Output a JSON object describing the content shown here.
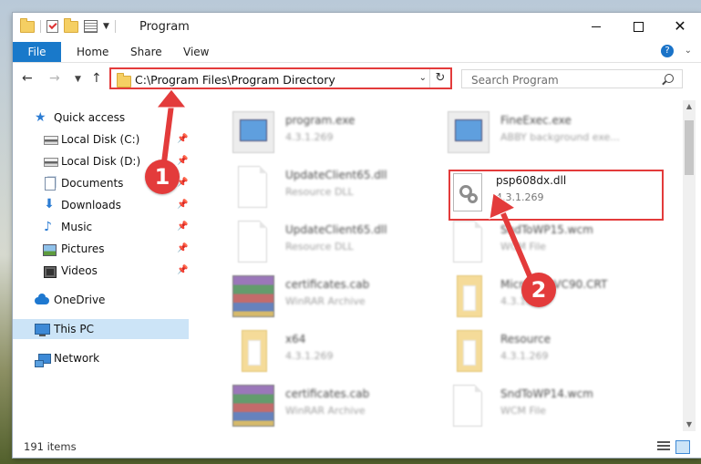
{
  "window": {
    "title": "Program"
  },
  "ribbon": {
    "tabs": [
      "File",
      "Home",
      "Share",
      "View"
    ]
  },
  "address": {
    "path": "C:\\Program Files\\Program Directory"
  },
  "search": {
    "placeholder": "Search Program"
  },
  "sidebar": {
    "items": [
      {
        "label": "Quick access",
        "icon": "star-icon"
      },
      {
        "label": "Local Disk (C:)",
        "icon": "disk-icon",
        "pinned": true
      },
      {
        "label": "Local Disk (D:)",
        "icon": "disk-icon",
        "pinned": true
      },
      {
        "label": "Documents",
        "icon": "documents-icon",
        "pinned": true
      },
      {
        "label": "Downloads",
        "icon": "download-icon",
        "pinned": true
      },
      {
        "label": "Music",
        "icon": "music-icon",
        "pinned": true
      },
      {
        "label": "Pictures",
        "icon": "pictures-icon",
        "pinned": true
      },
      {
        "label": "Videos",
        "icon": "video-icon",
        "pinned": true
      },
      {
        "label": "OneDrive",
        "icon": "cloud-icon"
      },
      {
        "label": "This PC",
        "icon": "computer-icon",
        "selected": true
      },
      {
        "label": "Network",
        "icon": "network-icon"
      }
    ]
  },
  "files": [
    {
      "name": "program.exe",
      "sub": "4.3.1.269",
      "icon": "exe"
    },
    {
      "name": "FineExec.exe",
      "sub": "ABBY background exe...",
      "icon": "exe"
    },
    {
      "name": "UpdateClient65.dll",
      "sub": "Resource DLL",
      "icon": "doc"
    },
    {
      "name": "psp608dx.dll",
      "sub": "4.3.1.269",
      "icon": "gears",
      "highlighted": true
    },
    {
      "name": "UpdateClient65.dll",
      "sub": "Resource DLL",
      "icon": "doc"
    },
    {
      "name": "SndToWP15.wcm",
      "sub": "WCM File",
      "icon": "doc"
    },
    {
      "name": "certificates.cab",
      "sub": "WinRAR Archive",
      "icon": "rar"
    },
    {
      "name": "Microsoft.VC90.CRT",
      "sub": "4.3.1.269",
      "icon": "folder"
    },
    {
      "name": "x64",
      "sub": "4.3.1.269",
      "icon": "folder"
    },
    {
      "name": "Resource",
      "sub": "4.3.1.269",
      "icon": "folder"
    },
    {
      "name": "certificates.cab",
      "sub": "WinRAR Archive",
      "icon": "rar"
    },
    {
      "name": "SndToWP14.wcm",
      "sub": "WCM File",
      "icon": "doc"
    }
  ],
  "status": {
    "count": "191 items"
  },
  "callouts": [
    "1",
    "2"
  ],
  "colors": {
    "accent": "#1979ca",
    "highlight": "#e33b3b",
    "selection": "#cce4f7"
  }
}
